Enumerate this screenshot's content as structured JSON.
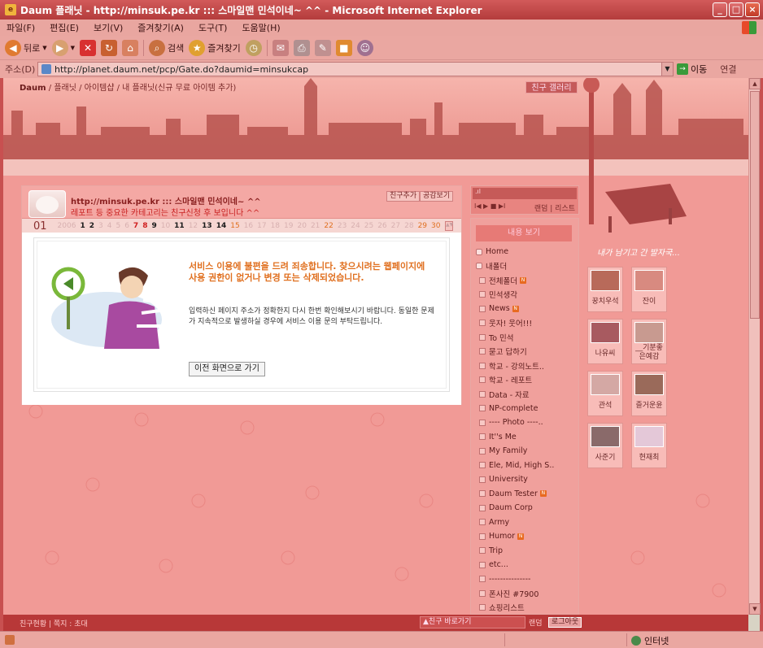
{
  "window": {
    "title": "Daum 플래닛 - http://minsuk.pe.kr ::: 스마일맨 민석이네~ ^^ - Microsoft Internet Explorer",
    "minimize": "_",
    "maximize": "□",
    "close": "×"
  },
  "menubar": {
    "items": [
      "파일(F)",
      "편집(E)",
      "보기(V)",
      "즐겨찾기(A)",
      "도구(T)",
      "도움말(H)"
    ]
  },
  "toolbar": {
    "back_label": "뒤로",
    "search_label": "검색",
    "favorites_label": "즐겨찾기"
  },
  "addressbar": {
    "label": "주소(D)",
    "url": "http://planet.daum.net/pcp/Gate.do?daumid=minsukcap",
    "go_label": "이동",
    "links_label": "연결"
  },
  "page": {
    "breadcrumb": {
      "daum": "Daum",
      "rest": "/ 플래닛 / 아이템샵 / 내 플래닛(신규 무료 아이템 추가)"
    },
    "friend_gallery": "친구 갤러리",
    "profile": {
      "url_text": "http://minsuk.pe.kr ::: 스마일맨 민석이네~ ^^",
      "note": "레포트 등 중요한 카테고리는 친구신청 후 보입니다 ^^",
      "add_friend": "친구추가",
      "empathy": "공감보기"
    },
    "datebar": {
      "month": "01",
      "year": "2006",
      "days": [
        {
          "n": "1",
          "s": "k"
        },
        {
          "n": "2",
          "s": "k"
        },
        {
          "n": "3",
          "s": "d"
        },
        {
          "n": "4",
          "s": "d"
        },
        {
          "n": "5",
          "s": "d"
        },
        {
          "n": "6",
          "s": "d"
        },
        {
          "n": "7",
          "s": "r"
        },
        {
          "n": "8",
          "s": "r"
        },
        {
          "n": "9",
          "s": "k"
        },
        {
          "n": "10",
          "s": "d"
        },
        {
          "n": "11",
          "s": "k"
        },
        {
          "n": "12",
          "s": "d"
        },
        {
          "n": "13",
          "s": "k"
        },
        {
          "n": "14",
          "s": "k"
        },
        {
          "n": "15",
          "s": "o"
        },
        {
          "n": "16",
          "s": "d"
        },
        {
          "n": "17",
          "s": "d"
        },
        {
          "n": "18",
          "s": "d"
        },
        {
          "n": "19",
          "s": "d"
        },
        {
          "n": "20",
          "s": "d"
        },
        {
          "n": "21",
          "s": "d"
        },
        {
          "n": "22",
          "s": "o"
        },
        {
          "n": "23",
          "s": "d"
        },
        {
          "n": "24",
          "s": "d"
        },
        {
          "n": "25",
          "s": "d"
        },
        {
          "n": "26",
          "s": "d"
        },
        {
          "n": "27",
          "s": "d"
        },
        {
          "n": "28",
          "s": "d"
        },
        {
          "n": "29",
          "s": "o"
        },
        {
          "n": "30",
          "s": "o"
        },
        {
          "n": "31",
          "s": "d"
        }
      ]
    },
    "error": {
      "title": "서비스 이용에 불편을 드려 죄송합니다. 찾으시려는 웹페이지에 사용 권한이 없거나 변경 또는 삭제되었습니다.",
      "body": "입력하신 페이지 주소가 정확한지 다시 한번 확인해보시기 바랍니다. 동일한 문제가 지속적으로 발생하실 경우에 서비스 이용 문의 부탁드립니다.",
      "button": "이전 화면으로 가기"
    },
    "player": {
      "screen": ".ıl",
      "controls": "I◀ ▶ ■ ▶I",
      "mode": "랜덤 | 리스트"
    },
    "menu": {
      "title": "내용 보기",
      "items": [
        {
          "label": "Home",
          "type": "top",
          "new": false
        },
        {
          "label": "내폴더",
          "type": "top",
          "new": false
        },
        {
          "label": "전체폴더",
          "type": "sub",
          "new": true
        },
        {
          "label": "민석생각",
          "type": "sub",
          "new": false
        },
        {
          "label": "News",
          "type": "sub",
          "new": true
        },
        {
          "label": "웃자! 웃어!!!",
          "type": "sub",
          "new": false
        },
        {
          "label": "To 민석",
          "type": "sub",
          "new": false
        },
        {
          "label": "묻고 답하기",
          "type": "sub",
          "new": false
        },
        {
          "label": "학교 - 강의노트..",
          "type": "sub",
          "new": false
        },
        {
          "label": "학교 - 레포트",
          "type": "sub",
          "new": false
        },
        {
          "label": "Data - 자료",
          "type": "sub",
          "new": false
        },
        {
          "label": "NP-complete",
          "type": "sub",
          "new": false
        },
        {
          "label": "---- Photo ----..",
          "type": "sub",
          "new": false
        },
        {
          "label": "It''s Me",
          "type": "sub",
          "new": false
        },
        {
          "label": "My Family",
          "type": "sub",
          "new": false
        },
        {
          "label": "Ele, Mid, High S..",
          "type": "sub",
          "new": false
        },
        {
          "label": "University",
          "type": "sub",
          "new": false
        },
        {
          "label": "Daum Tester",
          "type": "sub",
          "new": true
        },
        {
          "label": "Daum Corp",
          "type": "sub",
          "new": false
        },
        {
          "label": "Army",
          "type": "sub",
          "new": false
        },
        {
          "label": "Humor",
          "type": "sub",
          "new": true
        },
        {
          "label": "Trip",
          "type": "sub",
          "new": false
        },
        {
          "label": "etc...",
          "type": "sub",
          "new": false
        },
        {
          "label": "---------------",
          "type": "sub",
          "new": false
        },
        {
          "label": "폰사진 #7900",
          "type": "sub",
          "new": false
        },
        {
          "label": "쇼핑리스트",
          "type": "sub",
          "new": false
        }
      ]
    },
    "handwrite": "내가 남기고 간 발자국...",
    "friends": [
      {
        "name": "꿍치우석",
        "color": "#b86a5a"
      },
      {
        "name": "잔이",
        "color": "#d88a80"
      },
      {
        "name": "나유씨",
        "color": "#a85a60"
      },
      {
        "name": "__기분좋은예감",
        "color": "#c89a90"
      },
      {
        "name": "관석",
        "color": "#d4a8a4"
      },
      {
        "name": "즐거운윤",
        "color": "#9a6a5a"
      },
      {
        "name": "사준기",
        "color": "#8a6a6a"
      },
      {
        "name": "현재최",
        "color": "#e4c8d8"
      }
    ]
  },
  "pagebar": {
    "left": "친구현황 | 쪽지 : 초대",
    "select": "▲친구 바로가기",
    "random": "랜덤",
    "logout": "로그아웃"
  },
  "statusbar": {
    "zone": "인터넷"
  }
}
